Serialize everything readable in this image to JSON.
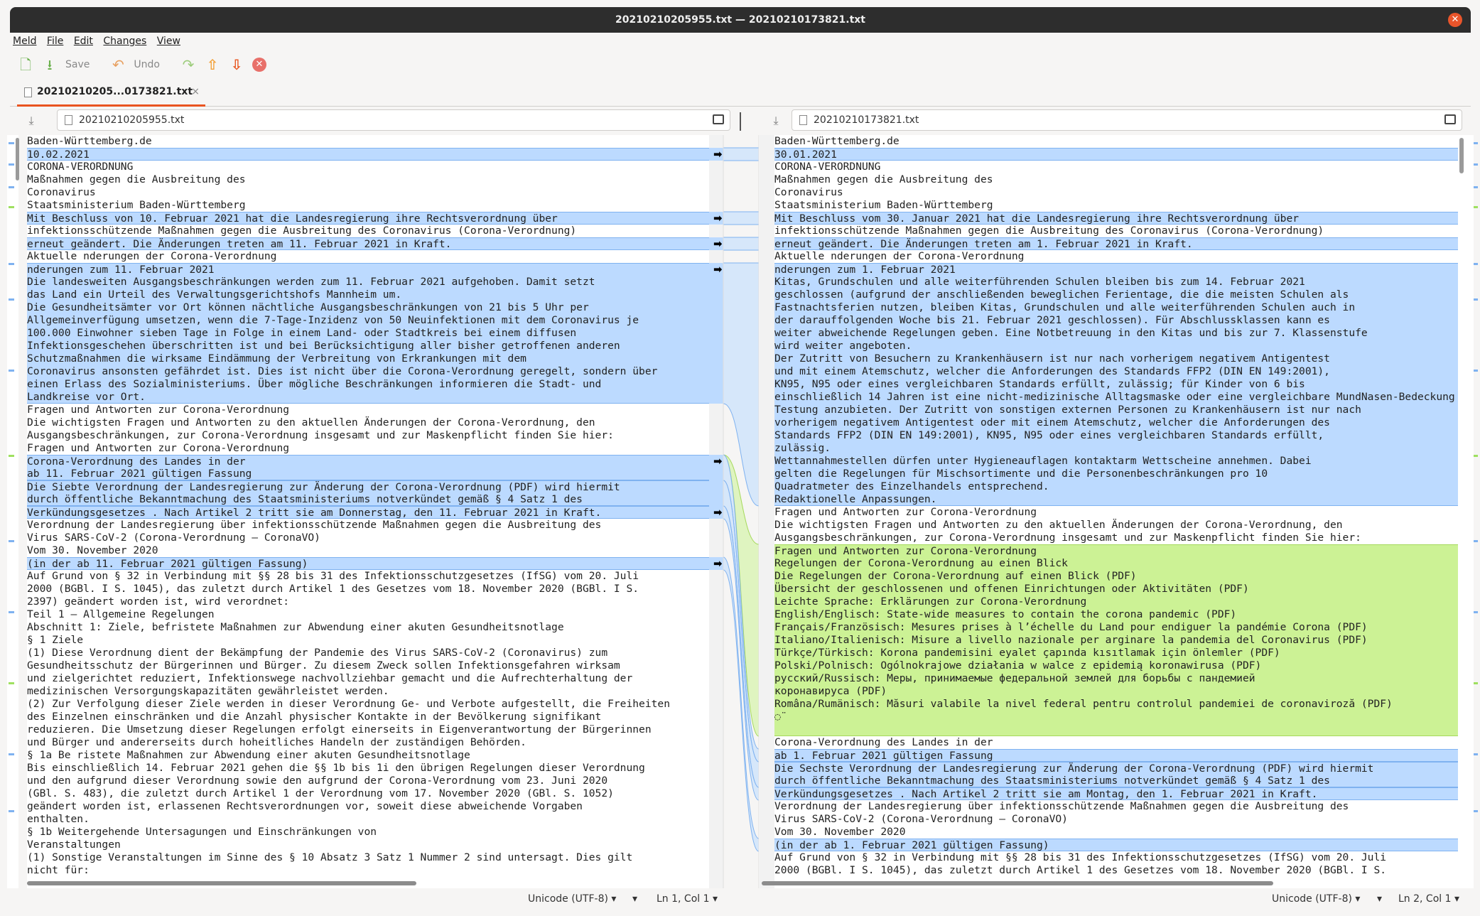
{
  "window": {
    "title": "20210210205955.txt — 20210210173821.txt"
  },
  "menu": [
    "Meld",
    "File",
    "Edit",
    "Changes",
    "View"
  ],
  "toolbar": {
    "save_label": "Save",
    "undo_label": "Undo"
  },
  "tab": {
    "label": "20210210205...0173821.txt"
  },
  "left": {
    "filename": "20210210205955.txt",
    "encoding": "Unicode (UTF-8)",
    "position": "Ln 1, Col 1",
    "lines": [
      "Baden-Württemberg.de",
      "10.02.2021",
      "CORONA-VERORDNUNG",
      "Maßnahmen gegen die Ausbreitung des",
      "Coronavirus",
      "Staatsministerium Baden-Württemberg",
      "Mit Beschluss von 10. Februar 2021 hat die Landesregierung ihre Rechtsverordnung über",
      "infektionsschützende Maßnahmen gegen die Ausbreitung des Coronavirus (Corona-Verordnung)",
      "erneut geändert. Die Änderungen treten am 11. Februar 2021 in Kraft.",
      "Aktuelle nderungen der Corona-Verordnung",
      "nderungen zum 11. Februar 2021",
      "Die landesweiten Ausgangsbeschränkungen werden zum 11. Februar 2021 aufgehoben. Damit setzt",
      "das Land ein Urteil des Verwaltungsgerichtshofs Mannheim um.",
      "Die Gesundheitsämter vor Ort können nächtliche Ausgangsbeschränkungen von 21 bis 5 Uhr per",
      "Allgemeinverfügung umsetzen, wenn die 7-Tage-Inzidenz von 50 Neuinfektionen mit dem Coronavirus je",
      "100.000 Einwohner sieben Tage in Folge in einem Land- oder Stadtkreis bei einem diffusen",
      "Infektionsgeschehen überschritten ist und bei Berücksichtigung aller bisher getroffenen anderen",
      "Schutzmaßnahmen die wirksame Eindämmung der Verbreitung von Erkrankungen mit dem",
      "Coronavirus ansonsten gefährdet ist. Dies ist nicht über die Corona-Verordnung geregelt, sondern über",
      "einen Erlass des Sozialministeriums. Über mögliche Beschränkungen informieren die Stadt- und",
      "Landkreise vor Ort.",
      "Fragen und Antworten zur Corona-Verordnung",
      "Die wichtigsten Fragen und Antworten zu den aktuellen Änderungen der Corona-Verordnung, den",
      "Ausgangsbeschränkungen, zur Corona-Verordnung insgesamt und zur Maskenpflicht finden Sie hier:",
      "Fragen und Antworten zur Corona-Verordnung",
      "Corona-Verordnung des Landes in der",
      "ab 11. Februar 2021 gültigen Fassung",
      "Die Siebte Verordnung der Landesregierung zur Änderung der Corona-Verordnung (PDF) wird hiermit",
      "durch öffentliche Bekanntmachung des Staatsministeriums notverkündet gemäß § 4 Satz 1 des",
      "Verkündungsgesetzes . Nach Artikel 2 tritt sie am Donnerstag, den 11. Februar 2021 in Kraft.",
      "Verordnung der Landesregierung über infektionsschützende Maßnahmen gegen die Ausbreitung des",
      "Virus SARS-CoV-2 (Corona-Verordnung – CoronaVO)",
      "Vom 30. November 2020",
      "(in der ab 11. Februar 2021 gültigen Fassung)",
      "Auf Grund von § 32 in Verbindung mit §§ 28 bis 31 des Infektionsschutzgesetzes (IfSG) vom 20. Juli",
      "2000 (BGBl. I S. 1045), das zuletzt durch Artikel 1 des Gesetzes vom 18. November 2020 (BGBl. I S.",
      "2397) geändert worden ist, wird verordnet:",
      "Teil 1 – Allgemeine Regelungen",
      "Abschnitt 1: Ziele, befristete Maßnahmen zur Abwendung einer akuten Gesundheitsnotlage",
      "§ 1 Ziele",
      "(1) Diese Verordnung dient der Bekämpfung der Pandemie des Virus SARS-CoV-2 (Coronavirus) zum",
      "Gesundheitsschutz der Bürgerinnen und Bürger. Zu diesem Zweck sollen Infektionsgefahren wirksam",
      "und zielgerichtet reduziert, Infektionswege nachvollziehbar gemacht und die Aufrechterhaltung der",
      "medizinischen Versorgungskapazitäten gewährleistet werden.",
      "(2) Zur Verfolgung dieser Ziele werden in dieser Verordnung Ge- und Verbote aufgestellt, die Freiheiten",
      "des Einzelnen einschränken und die Anzahl physischer Kontakte in der Bevölkerung signifikant",
      "reduzieren. Die Umsetzung dieser Regelungen erfolgt einerseits in Eigenverantwortung der Bürgerinnen",
      "und Bürger und andererseits durch hoheitliches Handeln der zuständigen Behörden.",
      "§ 1a Be ristete Maßnahmen zur Abwendung einer akuten Gesundheitsnotlage",
      "Bis einschließlich 14. Februar 2021 gehen die §§ 1b bis 1i den übrigen Regelungen dieser Verordnung",
      "und den aufgrund dieser Verordnung sowie den aufgrund der Corona-Verordnung vom 23. Juni 2020",
      "(GBl. S. 483), die zuletzt durch Artikel 1 der Verordnung vom 17. November 2020 (GBl. S. 1052)",
      "geändert worden ist, erlassenen Rechtsverordnungen vor, soweit diese abweichende Vorgaben",
      "enthalten.",
      "§ 1b Weitergehende Untersagungen und Einschränkungen von",
      "Veranstaltungen",
      "(1) Sonstige Veranstaltungen im Sinne des § 10 Absatz 3 Satz 1 Nummer 2 sind untersagt. Dies gilt",
      "nicht für:"
    ]
  },
  "right": {
    "filename": "20210210173821.txt",
    "encoding": "Unicode (UTF-8)",
    "position": "Ln 2, Col 1",
    "lines": [
      "Baden-Württemberg.de",
      "30.01.2021",
      "CORONA-VERORDNUNG",
      "Maßnahmen gegen die Ausbreitung des",
      "Coronavirus",
      "Staatsministerium Baden-Württemberg",
      "Mit Beschluss vom 30. Januar 2021 hat die Landesregierung ihre Rechtsverordnung über",
      "infektionsschützende Maßnahmen gegen die Ausbreitung des Coronavirus (Corona-Verordnung)",
      "erneut geändert. Die Änderungen treten am 1. Februar 2021 in Kraft.",
      "Aktuelle nderungen der Corona-Verordnung",
      "nderungen zum 1. Februar 2021",
      "Kitas, Grundschulen und alle weiterführenden Schulen bleiben bis zum 14. Februar 2021",
      "geschlossen (aufgrund der anschließenden beweglichen Ferientage, die die meisten Schulen als",
      "Fastnachtsferien nutzen, bleiben Kitas, Grundschulen und alle weiterführenden Schulen auch in",
      "der darauffolgenden Woche bis 21. Februar 2021 geschlossen). Für Abschlussklassen kann es",
      "weiter abweichende Regelungen geben. Eine Notbetreuung in den Kitas und bis zur 7. Klassenstufe",
      "wird weiter angeboten.",
      "Der Zutritt von Besuchern zu Krankenhäusern ist nur nach vorherigem negativem Antigentest",
      "und mit einem Atemschutz, welcher die Anforderungen des Standards FFP2 (DIN EN 149:2001),",
      "KN95, N95 oder eines vergleichbaren Standards erfüllt, zulässig; für Kinder von 6 bis",
      "einschließlich 14 Jahren ist eine nicht-medizinische Alltagsmaske oder eine vergleichbare MundNasen-Bedeckung",
      "Testung anzubieten. Der Zutritt von sonstigen externen Personen zu Krankenhäusern ist nur nach",
      "vorherigem negativem Antigentest oder mit einem Atemschutz, welcher die Anforderungen des",
      "Standards FFP2 (DIN EN 149:2001), KN95, N95 oder eines vergleichbaren Standards erfüllt,",
      "zulässig.",
      "Wettannahmestellen dürfen unter Hygieneauflagen kontaktarm Wettscheine annehmen. Dabei",
      "gelten die Regelungen für Mischsortimente und die Personenbeschränkungen pro 10",
      "Quadratmeter des Einzelhandels entsprechend.",
      "Redaktionelle Anpassungen.",
      "Fragen und Antworten zur Corona-Verordnung",
      "Die wichtigsten Fragen und Antworten zu den aktuellen Änderungen der Corona-Verordnung, den",
      "Ausgangsbeschränkungen, zur Corona-Verordnung insgesamt und zur Maskenpflicht finden Sie hier:",
      "Fragen und Antworten zur Corona-Verordnung",
      "Regelungen der Corona-Verordnung au einen Blick",
      "Die Regelungen der Corona-Verordnung auf einen Blick (PDF)",
      "Übersicht der geschlossenen und offenen Einrichtungen oder Aktivitäten (PDF)",
      "Leichte Sprache: Erklärungen zur Corona-Verordnung",
      "English/Englisch: State-wide measures to contain the corona pandemic (PDF)",
      "Français/Französisch: Mesures prises à l’échelle du Land pour endiguer la pandémie Corona (PDF)",
      "Italiano/Italienisch: Misure a livello nazionale per arginare la pandemia del Coronavirus (PDF)",
      "Türkçe/Türkisch: Korona pandemisini eyalet çapında kısıtlamak için önlemler (PDF)",
      "Polski/Polnisch: Ogólnokrajowe działania w walce z epidemią koronawirusa (PDF)",
      "русский/Russisch: Меры, принимаемые федеральной землей для борьбы с пандемией",
      "коронавируса (PDF)",
      "Româna/Rumänisch: Măsuri valabile la nivel federal pentru controlul pandemiei de coronaviroză (PDF)",
      "◌̈",
      "",
      "Corona-Verordnung des Landes in der",
      "ab 1. Februar 2021 gültigen Fassung",
      "Die Sechste Verordnung der Landesregierung zur Änderung der Corona-Verordnung (PDF) wird hiermit",
      "durch öffentliche Bekanntmachung des Staatsministeriums notverkündet gemäß § 4 Satz 1 des",
      "Verkündungsgesetzes . Nach Artikel 2 tritt sie am Montag, den 1. Februar 2021 in Kraft.",
      "Verordnung der Landesregierung über infektionsschützende Maßnahmen gegen die Ausbreitung des",
      "Virus SARS-CoV-2 (Corona-Verordnung – CoronaVO)",
      "Vom 30. November 2020",
      "(in der ab 1. Februar 2021 gültigen Fassung)",
      "Auf Grund von § 32 in Verbindung mit §§ 28 bis 31 des Infektionsschutzgesetzes (IfSG) vom 20. Juli",
      "2000 (BGBl. I S. 1045), das zuletzt durch Artikel 1 des Gesetzes vom 18. November 2020 (BGBl. I S."
    ]
  }
}
